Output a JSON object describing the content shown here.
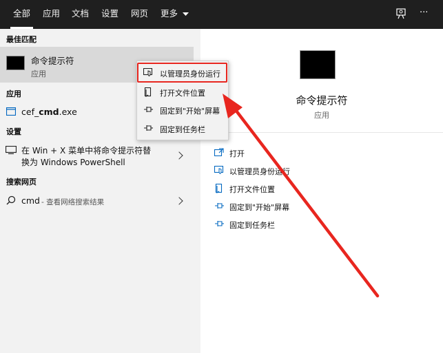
{
  "topbar": {
    "tabs": [
      {
        "label": "全部",
        "active": true
      },
      {
        "label": "应用"
      },
      {
        "label": "文档"
      },
      {
        "label": "设置"
      },
      {
        "label": "网页"
      },
      {
        "label": "更多"
      }
    ],
    "icons": [
      "feedback-icon",
      "more-icon"
    ],
    "more_glyph": "···"
  },
  "left": {
    "best_match_label": "最佳匹配",
    "best_match": {
      "title": "命令提示符",
      "subtitle": "应用"
    },
    "apps_label": "应用",
    "app_item": {
      "prefix": "cef_",
      "bold": "cmd",
      "suffix": ".exe"
    },
    "settings_label": "设置",
    "settings_item": {
      "line1": "在 Win + X 菜单中将命令提示符替",
      "line2": "换为 Windows PowerShell"
    },
    "web_label": "搜索网页",
    "web_item": {
      "query": "cmd",
      "hint": " - 查看网络搜索结果"
    }
  },
  "context_menu": {
    "items": [
      "以管理员身份运行",
      "打开文件位置",
      "固定到\"开始\"屏幕",
      "固定到任务栏"
    ]
  },
  "right": {
    "title": "命令提示符",
    "subtitle": "应用",
    "actions": [
      "打开",
      "以管理员身份运行",
      "打开文件位置",
      "固定到\"开始\"屏幕",
      "固定到任务栏"
    ]
  },
  "colors": {
    "accent": "#0067c0",
    "highlight": "#e8261f",
    "topbar": "#1f1f1f"
  }
}
